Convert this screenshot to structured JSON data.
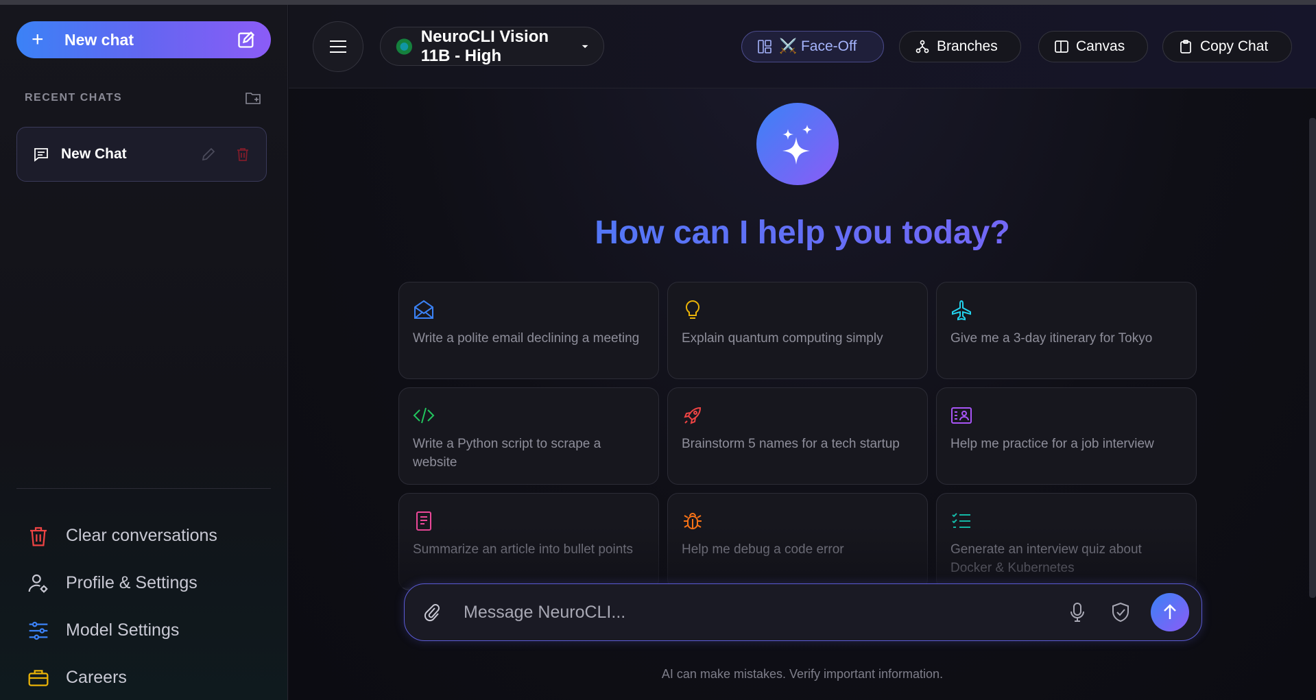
{
  "sidebar": {
    "new_chat_label": "New chat",
    "recent_title": "RECENT CHATS",
    "chats": [
      {
        "label": "New Chat"
      }
    ],
    "menu": [
      {
        "label": "Clear conversations",
        "icon": "trash-icon",
        "color": "#ef4444"
      },
      {
        "label": "Profile & Settings",
        "icon": "user-gear-icon",
        "color": "#c9c9d4"
      },
      {
        "label": "Model Settings",
        "icon": "sliders-icon",
        "color": "#3b82f6"
      },
      {
        "label": "Careers",
        "icon": "briefcase-icon",
        "color": "#eab308"
      }
    ]
  },
  "header": {
    "model_label": "NeuroCLI Vision 11B - High",
    "buttons": {
      "faceoff": "⚔️ Face-Off",
      "branches": "Branches",
      "canvas": "Canvas",
      "copy": "Copy Chat"
    }
  },
  "hero": {
    "title": "How can I help you today?"
  },
  "suggestions": [
    {
      "text": "Write a polite email declining a meeting",
      "icon": "envelope-icon",
      "color": "#3b82f6"
    },
    {
      "text": "Explain quantum computing simply",
      "icon": "lightbulb-icon",
      "color": "#eab308"
    },
    {
      "text": "Give me a 3-day itinerary for Tokyo",
      "icon": "airplane-icon",
      "color": "#22d3ee"
    },
    {
      "text": "Write a Python script to scrape a website",
      "icon": "code-icon",
      "color": "#22c55e"
    },
    {
      "text": "Brainstorm 5 names for a tech startup",
      "icon": "rocket-icon",
      "color": "#ef4444"
    },
    {
      "text": "Help me practice for a job interview",
      "icon": "id-card-icon",
      "color": "#a855f7"
    },
    {
      "text": "Summarize an article into bullet points",
      "icon": "document-icon",
      "color": "#ec4899"
    },
    {
      "text": "Help me debug a code error",
      "icon": "bug-icon",
      "color": "#f97316"
    },
    {
      "text": "Generate an interview quiz about Docker & Kubernetes",
      "icon": "checklist-icon",
      "color": "#14b8a6"
    }
  ],
  "composer": {
    "placeholder": "Message NeuroCLI...",
    "value": ""
  },
  "footer": {
    "disclaimer": "AI can make mistakes. Verify important information."
  }
}
